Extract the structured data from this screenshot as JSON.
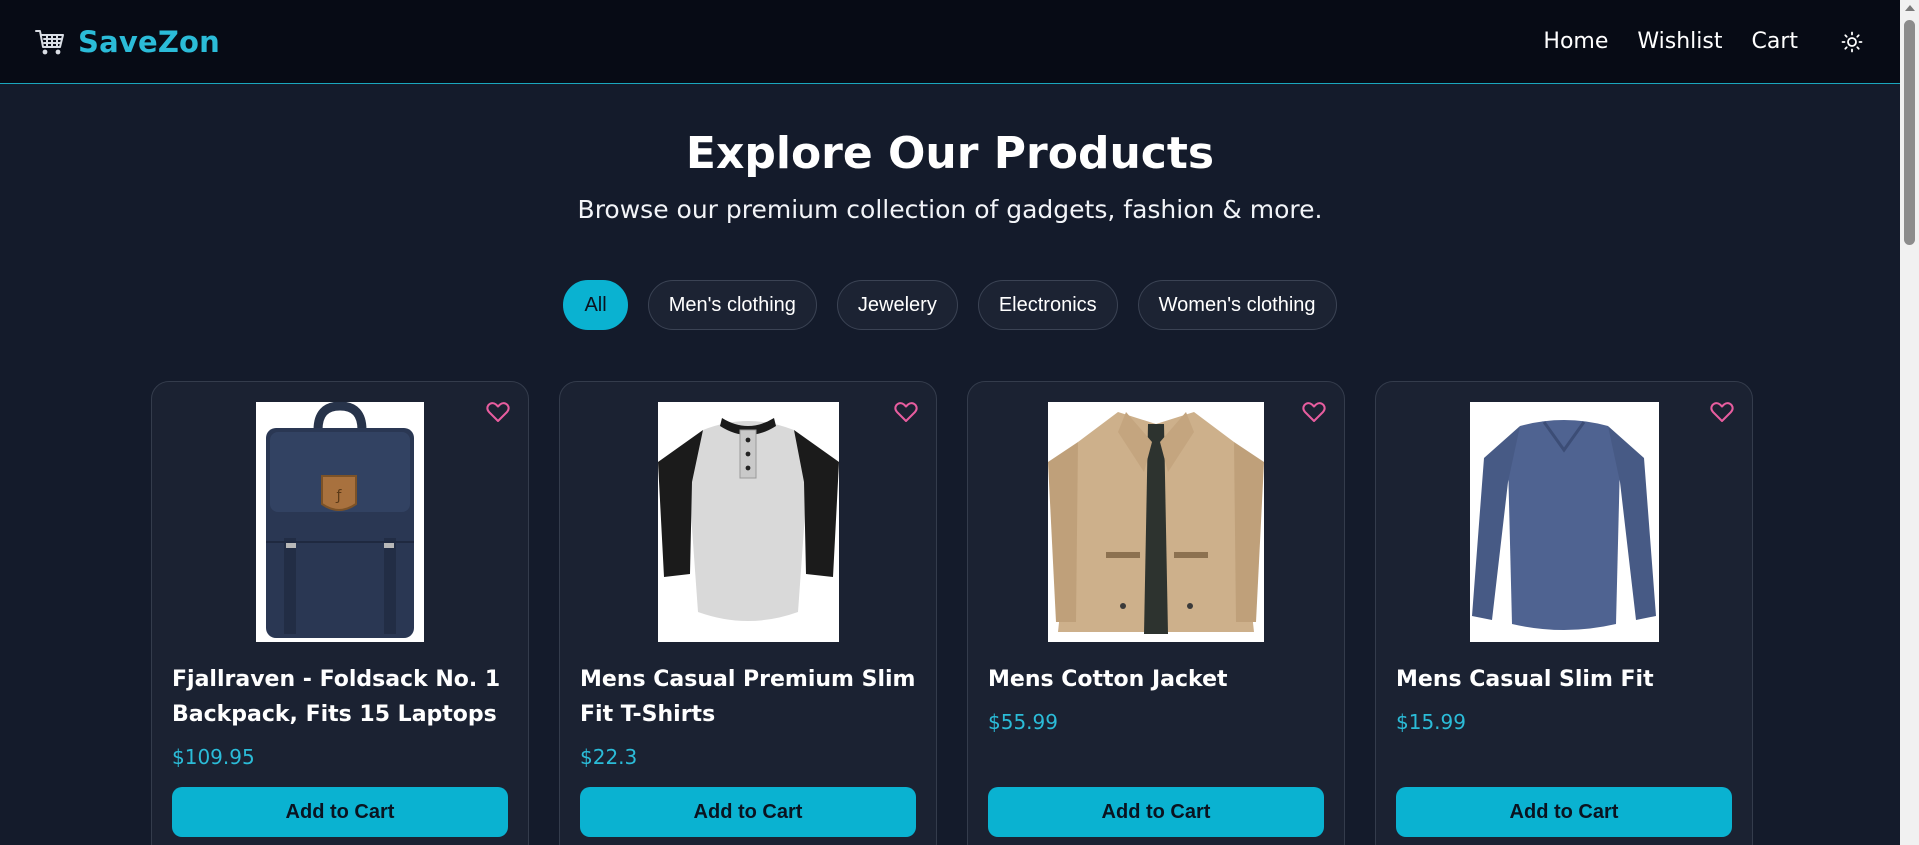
{
  "nav": {
    "brand": "SaveZon",
    "links": [
      "Home",
      "Wishlist",
      "Cart"
    ],
    "accent": "#2bbcd8"
  },
  "hero": {
    "title": "Explore Our Products",
    "subtitle": "Browse our premium collection of gadgets, fashion & more."
  },
  "filters": {
    "chips": [
      "All",
      "Men's clothing",
      "Jewelery",
      "Electronics",
      "Women's clothing"
    ],
    "active": "All"
  },
  "products": [
    {
      "title": "Fjallraven - Foldsack No. 1 Backpack, Fits 15 Laptops",
      "price": "$109.95",
      "button": "Add to Cart",
      "image": "navy-backpack"
    },
    {
      "title": "Mens Casual Premium Slim Fit T-Shirts",
      "price": "$22.3",
      "button": "Add to Cart",
      "image": "raglan-henley-tshirt"
    },
    {
      "title": "Mens Cotton Jacket",
      "price": "$55.99",
      "button": "Add to Cart",
      "image": "khaki-jacket"
    },
    {
      "title": "Mens Casual Slim Fit",
      "price": "$15.99",
      "button": "Add to Cart",
      "image": "blue-longsleeve-tshirt"
    }
  ],
  "icons": {
    "brand": "shopping-cart-icon",
    "theme": "sun-icon",
    "wishlist": "heart-outline-icon"
  },
  "colors": {
    "background": "#141b2b",
    "navbar": "#070b15",
    "button": "#0ab2d1",
    "heart": "#e85d9f"
  }
}
